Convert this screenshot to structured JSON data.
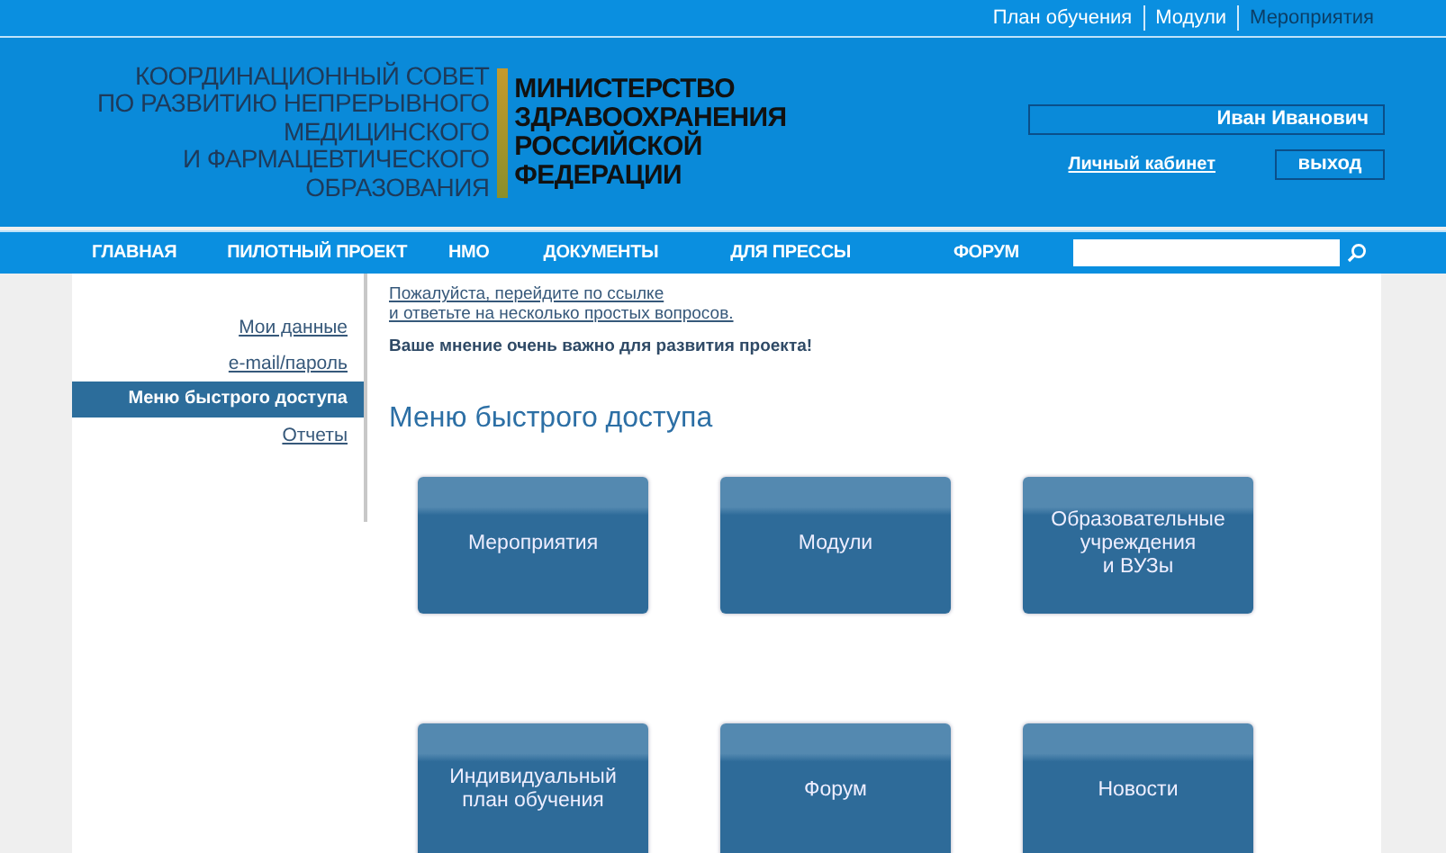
{
  "top_links": [
    {
      "label": "План обучения",
      "selected": false
    },
    {
      "label": "Модули",
      "selected": false
    },
    {
      "label": "Мероприятия",
      "selected": true
    }
  ],
  "logo": {
    "council_lines": [
      "КООРДИНАЦИОННЫЙ СОВЕТ",
      "ПО РАЗВИТИЮ НЕПРЕРЫВНОГО",
      "МЕДИЦИНСКОГО",
      "И ФАРМАЦЕВТИЧЕСКОГО",
      "ОБРАЗОВАНИЯ"
    ],
    "ministry_lines": [
      "МИНИСТЕРСТВО",
      "ЗДРАВООХРАНЕНИЯ",
      "РОССИЙСКОЙ",
      "ФЕДЕРАЦИИ"
    ]
  },
  "user": {
    "name": "Иван Иванович",
    "cabinet_link": "Личный кабинет",
    "logout": "выход"
  },
  "nav": [
    {
      "label": "ГЛАВНАЯ"
    },
    {
      "label": "ПИЛОТНЫЙ ПРОЕКТ"
    },
    {
      "label": "НМО"
    },
    {
      "label": "ДОКУМЕНТЫ"
    },
    {
      "label": "ДЛЯ ПРЕССЫ"
    },
    {
      "label": "ФОРУМ"
    }
  ],
  "sidebar": [
    {
      "label": "Мои данные",
      "selected": false
    },
    {
      "label": "e-mail/пароль",
      "selected": false
    },
    {
      "label": "Меню быстрого доступа",
      "selected": true
    },
    {
      "label": "Отчеты",
      "selected": false
    }
  ],
  "survey": {
    "link_lines": [
      "Пожалуйста, перейдите по ссылке",
      "и ответьте на несколько простых вопросов."
    ],
    "note": "Ваше мнение очень важно для развития проекта!"
  },
  "heading": "Меню быстрого доступа",
  "tiles": [
    {
      "lines": [
        "Мероприятия"
      ]
    },
    {
      "lines": [
        "Модули"
      ]
    },
    {
      "lines": [
        "Образовательные",
        "учреждения",
        "и ВУЗы"
      ]
    },
    {
      "lines": [
        "Индивидуальный",
        "план обучения"
      ]
    },
    {
      "lines": [
        "Форум"
      ]
    },
    {
      "lines": [
        "Новости"
      ]
    }
  ]
}
